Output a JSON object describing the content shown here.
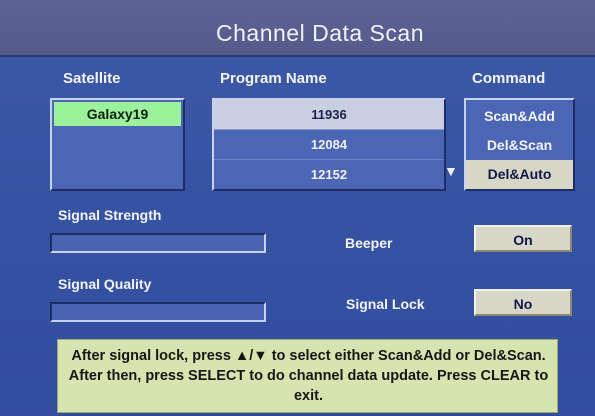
{
  "title": "Channel Data Scan",
  "headers": {
    "satellite": "Satellite",
    "program_name": "Program Name",
    "command": "Command"
  },
  "satellites": {
    "selected": "Galaxy19"
  },
  "programs": [
    {
      "label": "11936",
      "selected": true
    },
    {
      "label": "12084",
      "selected": false
    },
    {
      "label": "12152",
      "selected": false
    }
  ],
  "program_scroll_icon": "down-triangle",
  "commands": [
    {
      "label": "Scan&Add",
      "selected": false
    },
    {
      "label": "Del&Scan",
      "selected": false
    },
    {
      "label": "Del&Auto",
      "selected": true
    }
  ],
  "signal_strength": {
    "label": "Signal Strength",
    "level": 0
  },
  "signal_quality": {
    "label": "Signal Quality",
    "level": 0
  },
  "beeper": {
    "label": "Beeper",
    "value": "On"
  },
  "signal_lock": {
    "label": "Signal Lock",
    "value": "No"
  },
  "help_text": "After signal lock, press ▲/▼ to select either Scan&Add or Del&Scan. After then, press SELECT to do channel data update. Press CLEAR to exit.",
  "colors": {
    "background": "#3a56a4",
    "title_bar": "#585e90",
    "selection_green": "#9cf29a",
    "selection_light": "#d8d6c6",
    "help_box": "#d6e4b0"
  }
}
